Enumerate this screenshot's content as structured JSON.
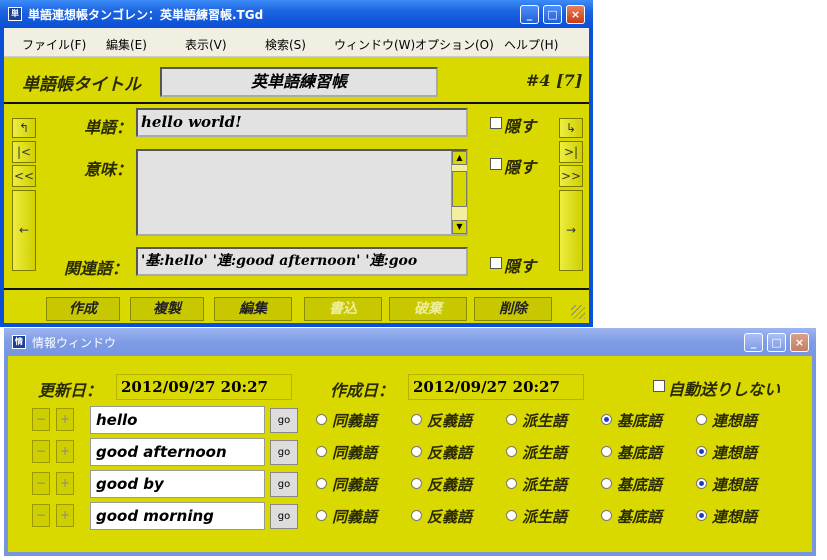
{
  "main_window": {
    "title": "単語連想帳タンゴレン：英単語練習帳.TGd",
    "menu": [
      "ファイル(F)",
      "編集(E)",
      "表示(V)",
      "検索(S)",
      "ウィンドウ(W)",
      "オプション(O)",
      "ヘルプ(H)"
    ],
    "book_title_label": "単語帳タイトル",
    "book_title": "英単語練習帳",
    "record_indicator": "#4 [7]",
    "word_label": "単語：",
    "word_value": "hello world!",
    "meaning_label": "意味：",
    "meaning_value": "",
    "related_label": "関連語：",
    "related_value": "'基:hello' '連:good afternoon' '連:goo",
    "hide_label": "隠す",
    "nav_left": [
      "↰",
      "|<",
      "<<",
      "←"
    ],
    "nav_right": [
      "↳",
      ">|",
      ">>",
      "→"
    ],
    "actions": [
      {
        "label": "作成",
        "enabled": true
      },
      {
        "label": "複製",
        "enabled": true
      },
      {
        "label": "編集",
        "enabled": true
      },
      {
        "label": "書込",
        "enabled": false
      },
      {
        "label": "破棄",
        "enabled": false
      },
      {
        "label": "削除",
        "enabled": true
      }
    ]
  },
  "info_window": {
    "title": "情報ウィンドウ",
    "updated_label": "更新日：",
    "updated_value": "2012/09/27 20:27",
    "created_label": "作成日：",
    "created_value": "2012/09/27 20:27",
    "auto_send_label": "自動送りしない",
    "go_label": "go",
    "relation_types": [
      "同義語",
      "反義語",
      "派生語",
      "基底語",
      "連想語"
    ],
    "rows": [
      {
        "word": "hello",
        "selected": 3
      },
      {
        "word": "good afternoon",
        "selected": 4
      },
      {
        "word": "good by",
        "selected": 4
      },
      {
        "word": "good morning",
        "selected": 4
      }
    ]
  },
  "colors": {
    "panel_yellow": "#d9d900",
    "titlebar_active": "#0a4fd6",
    "titlebar_inactive": "#7796e0"
  }
}
